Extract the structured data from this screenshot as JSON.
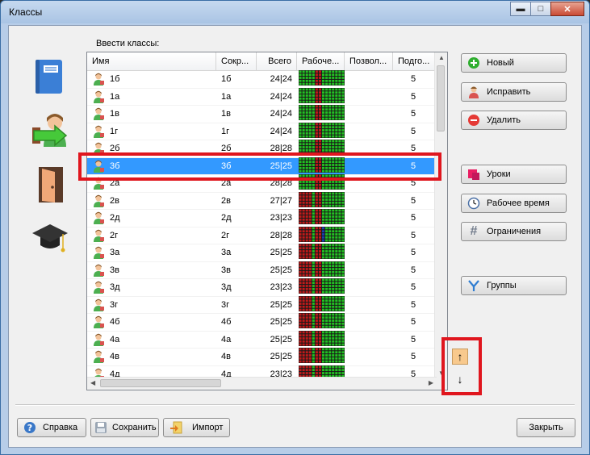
{
  "window": {
    "title": "Классы",
    "minimize": "▬",
    "maximize": "□",
    "close": "✕"
  },
  "grid_label": "Ввести классы:",
  "columns": [
    "Имя",
    "Сокр...",
    "Всего",
    "Рабоче...",
    "Позвол...",
    "Подго..."
  ],
  "rows": [
    {
      "name": "1б",
      "short": "1б",
      "total": "24|24",
      "sub": "5"
    },
    {
      "name": "1а",
      "short": "1а",
      "total": "24|24",
      "sub": "5"
    },
    {
      "name": "1в",
      "short": "1в",
      "total": "24|24",
      "sub": "5"
    },
    {
      "name": "1г",
      "short": "1г",
      "total": "24|24",
      "sub": "5"
    },
    {
      "name": "2б",
      "short": "2б",
      "total": "28|28",
      "sub": "5"
    },
    {
      "name": "3б",
      "short": "3б",
      "total": "25|25",
      "sub": "5",
      "selected": true
    },
    {
      "name": "2а",
      "short": "2а",
      "total": "28|28",
      "sub": "5"
    },
    {
      "name": "2в",
      "short": "2в",
      "total": "27|27",
      "sub": "5"
    },
    {
      "name": "2д",
      "short": "2д",
      "total": "23|23",
      "sub": "5"
    },
    {
      "name": "2г",
      "short": "2г",
      "total": "28|28",
      "sub": "5"
    },
    {
      "name": "3а",
      "short": "3а",
      "total": "25|25",
      "sub": "5"
    },
    {
      "name": "3в",
      "short": "3в",
      "total": "25|25",
      "sub": "5"
    },
    {
      "name": "3д",
      "short": "3д",
      "total": "23|23",
      "sub": "5"
    },
    {
      "name": "3г",
      "short": "3г",
      "total": "25|25",
      "sub": "5"
    },
    {
      "name": "4б",
      "short": "4б",
      "total": "25|25",
      "sub": "5"
    },
    {
      "name": "4а",
      "short": "4а",
      "total": "25|25",
      "sub": "5"
    },
    {
      "name": "4в",
      "short": "4в",
      "total": "25|25",
      "sub": "5"
    },
    {
      "name": "4д",
      "short": "4д",
      "total": "23|23",
      "sub": "5"
    }
  ],
  "right_buttons": {
    "new": "Новый",
    "edit": "Исправить",
    "delete": "Удалить",
    "lessons": "Уроки",
    "worktime": "Рабочее время",
    "constraints": "Ограничения",
    "groups": "Группы"
  },
  "move": {
    "up": "↑",
    "down": "↓"
  },
  "bottom_buttons": {
    "help": "Справка",
    "save": "Сохранить",
    "import": "Импорт",
    "close": "Закрыть"
  },
  "colors": {
    "selection": "#3399ff",
    "highlight": "#e0161e",
    "worktime_green": "#22c322",
    "worktime_red": "#c01a1a"
  },
  "icons": {
    "sidebar": [
      "book-icon",
      "class-arrow-icon",
      "door-icon",
      "graduation-cap-icon"
    ],
    "row": "student-icon"
  }
}
